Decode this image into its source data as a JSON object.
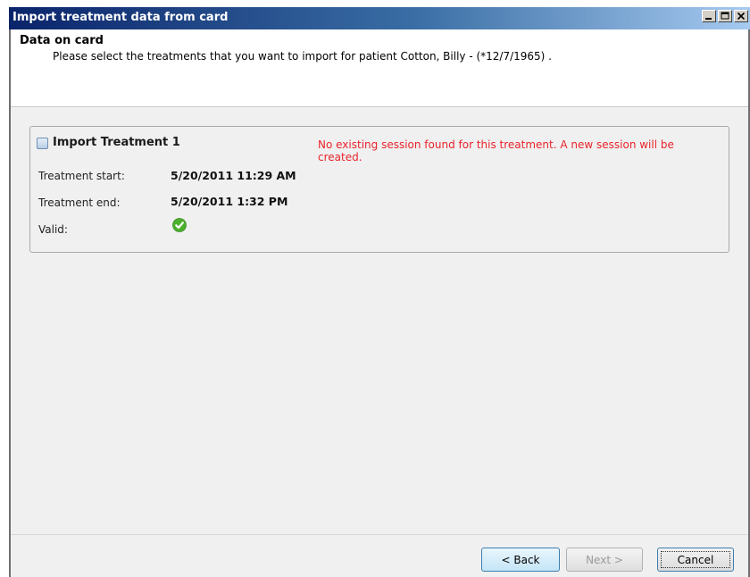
{
  "window": {
    "title": "Import treatment data from card",
    "controls": {
      "minimize_icon": "minimize-icon",
      "maximize_icon": "maximize-icon",
      "close_icon": "close-icon"
    }
  },
  "header": {
    "title": "Data on card",
    "subtitle": "Please select the treatments that you want to import for patient Cotton, Billy - (*12/7/1965) ."
  },
  "treatment": {
    "checkbox_checked": false,
    "title": "Import Treatment 1",
    "warning": "No existing session found for this treatment. A new session will be created.",
    "start_label": "Treatment start:",
    "start_value": "5/20/2011 11:29 AM",
    "end_label": "Treatment end:",
    "end_value": "5/20/2011 1:32 PM",
    "valid_label": "Valid:",
    "valid_icon": "check-circle-icon"
  },
  "buttons": {
    "back": "< Back",
    "next": "Next >",
    "cancel": "Cancel"
  },
  "colors": {
    "warning": "#e8242b",
    "valid": "#4caf2e",
    "titlebar": "#0a246a"
  }
}
